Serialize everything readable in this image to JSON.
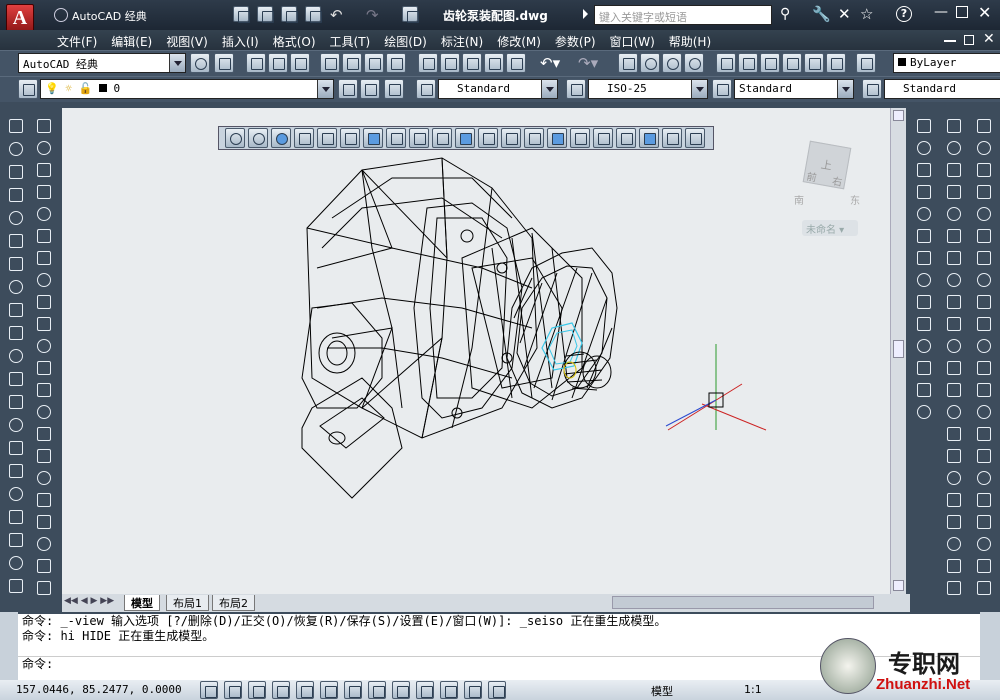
{
  "app": {
    "workspace": "AutoCAD 经典",
    "file": "齿轮泵装配图.dwg",
    "search_placeholder": "键入关键字或短语"
  },
  "menu": [
    "文件(F)",
    "编辑(E)",
    "视图(V)",
    "插入(I)",
    "格式(O)",
    "工具(T)",
    "绘图(D)",
    "标注(N)",
    "修改(M)",
    "参数(P)",
    "窗口(W)",
    "帮助(H)"
  ],
  "toolbar": {
    "workspace_combo": "AutoCAD 经典",
    "layer": "0",
    "color": "ByLayer",
    "text_style": "Standard",
    "dim_style": "ISO-25",
    "table_style": "Standard",
    "multileader_style": "Standard"
  },
  "viewcube": {
    "label": "未命名",
    "top": "上",
    "front": "前",
    "right": "右",
    "south": "南",
    "east": "东"
  },
  "tabs": [
    "模型",
    "布局1",
    "布局2"
  ],
  "command": {
    "line1": "命令: _-view 输入选项 [?/删除(D)/正交(O)/恢复(R)/保存(S)/设置(E)/窗口(W)]: _seiso 正在重生成模型。",
    "line2": "命令: hi HIDE 正在重生成模型。",
    "prompt": "命令:"
  },
  "status": {
    "coords": "157.0446, 85.2477, 0.0000",
    "model": "模型",
    "scale": "1:1"
  },
  "watermark": {
    "brand": "专职网",
    "url": "Zhuanzhi.Net"
  }
}
